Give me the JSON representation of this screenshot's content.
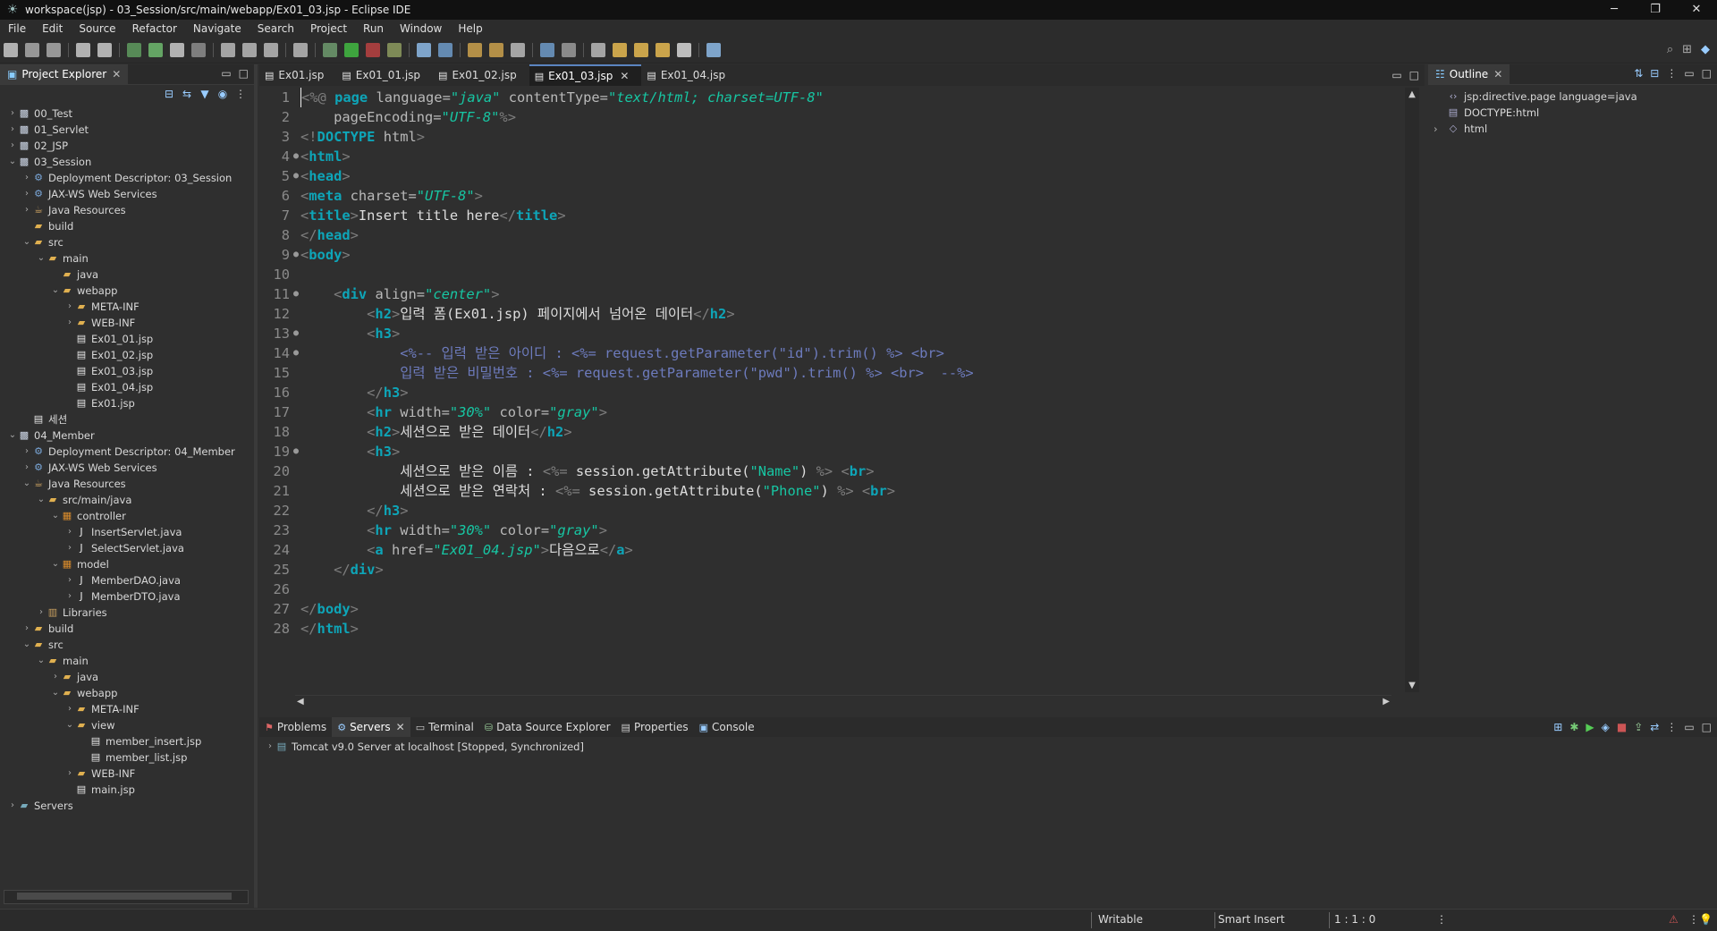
{
  "window": {
    "title": "workspace(jsp) - 03_Session/src/main/webapp/Ex01_03.jsp - Eclipse IDE",
    "controls": [
      "─",
      "❐",
      "✕"
    ]
  },
  "menu": [
    "File",
    "Edit",
    "Source",
    "Refactor",
    "Navigate",
    "Search",
    "Project",
    "Run",
    "Window",
    "Help"
  ],
  "explorer": {
    "tab_label": "Project Explorer",
    "items": [
      {
        "label": "00_Test",
        "depth": 0,
        "arrow": "›",
        "icon": "project"
      },
      {
        "label": "01_Servlet",
        "depth": 0,
        "arrow": "›",
        "icon": "project"
      },
      {
        "label": "02_JSP",
        "depth": 0,
        "arrow": "›",
        "icon": "project"
      },
      {
        "label": "03_Session",
        "depth": 0,
        "arrow": "⌄",
        "icon": "project"
      },
      {
        "label": "Deployment Descriptor: 03_Session",
        "depth": 1,
        "arrow": "›",
        "icon": "descriptor"
      },
      {
        "label": "JAX-WS Web Services",
        "depth": 1,
        "arrow": "›",
        "icon": "service"
      },
      {
        "label": "Java Resources",
        "depth": 1,
        "arrow": "›",
        "icon": "resources"
      },
      {
        "label": "build",
        "depth": 1,
        "arrow": "",
        "icon": "folder"
      },
      {
        "label": "src",
        "depth": 1,
        "arrow": "⌄",
        "icon": "folder"
      },
      {
        "label": "main",
        "depth": 2,
        "arrow": "⌄",
        "icon": "folder"
      },
      {
        "label": "java",
        "depth": 3,
        "arrow": "",
        "icon": "folder"
      },
      {
        "label": "webapp",
        "depth": 3,
        "arrow": "⌄",
        "icon": "folder"
      },
      {
        "label": "META-INF",
        "depth": 4,
        "arrow": "›",
        "icon": "folder"
      },
      {
        "label": "WEB-INF",
        "depth": 4,
        "arrow": "›",
        "icon": "folder"
      },
      {
        "label": "Ex01_01.jsp",
        "depth": 4,
        "arrow": "",
        "icon": "file"
      },
      {
        "label": "Ex01_02.jsp",
        "depth": 4,
        "arrow": "",
        "icon": "file"
      },
      {
        "label": "Ex01_03.jsp",
        "depth": 4,
        "arrow": "",
        "icon": "file"
      },
      {
        "label": "Ex01_04.jsp",
        "depth": 4,
        "arrow": "",
        "icon": "file"
      },
      {
        "label": "Ex01.jsp",
        "depth": 4,
        "arrow": "",
        "icon": "file"
      },
      {
        "label": "세션",
        "depth": 1,
        "arrow": "",
        "icon": "file"
      },
      {
        "label": "04_Member",
        "depth": 0,
        "arrow": "⌄",
        "icon": "project"
      },
      {
        "label": "Deployment Descriptor: 04_Member",
        "depth": 1,
        "arrow": "›",
        "icon": "descriptor"
      },
      {
        "label": "JAX-WS Web Services",
        "depth": 1,
        "arrow": "›",
        "icon": "service"
      },
      {
        "label": "Java Resources",
        "depth": 1,
        "arrow": "⌄",
        "icon": "resources"
      },
      {
        "label": "src/main/java",
        "depth": 2,
        "arrow": "⌄",
        "icon": "folder"
      },
      {
        "label": "controller",
        "depth": 3,
        "arrow": "⌄",
        "icon": "package"
      },
      {
        "label": "InsertServlet.java",
        "depth": 4,
        "arrow": "›",
        "icon": "java"
      },
      {
        "label": "SelectServlet.java",
        "depth": 4,
        "arrow": "›",
        "icon": "java"
      },
      {
        "label": "model",
        "depth": 3,
        "arrow": "⌄",
        "icon": "package"
      },
      {
        "label": "MemberDAO.java",
        "depth": 4,
        "arrow": "›",
        "icon": "java"
      },
      {
        "label": "MemberDTO.java",
        "depth": 4,
        "arrow": "›",
        "icon": "java"
      },
      {
        "label": "Libraries",
        "depth": 2,
        "arrow": "›",
        "icon": "library"
      },
      {
        "label": "build",
        "depth": 1,
        "arrow": "›",
        "icon": "folder"
      },
      {
        "label": "src",
        "depth": 1,
        "arrow": "⌄",
        "icon": "folder"
      },
      {
        "label": "main",
        "depth": 2,
        "arrow": "⌄",
        "icon": "folder"
      },
      {
        "label": "java",
        "depth": 3,
        "arrow": "›",
        "icon": "folder"
      },
      {
        "label": "webapp",
        "depth": 3,
        "arrow": "⌄",
        "icon": "folder"
      },
      {
        "label": "META-INF",
        "depth": 4,
        "arrow": "›",
        "icon": "folder"
      },
      {
        "label": "view",
        "depth": 4,
        "arrow": "⌄",
        "icon": "folder"
      },
      {
        "label": "member_insert.jsp",
        "depth": 5,
        "arrow": "",
        "icon": "file"
      },
      {
        "label": "member_list.jsp",
        "depth": 5,
        "arrow": "",
        "icon": "file"
      },
      {
        "label": "WEB-INF",
        "depth": 4,
        "arrow": "›",
        "icon": "folder"
      },
      {
        "label": "main.jsp",
        "depth": 4,
        "arrow": "",
        "icon": "file"
      },
      {
        "label": "Servers",
        "depth": 0,
        "arrow": "›",
        "icon": "server"
      }
    ]
  },
  "editor": {
    "tabs": [
      {
        "label": "Ex01.jsp",
        "active": false
      },
      {
        "label": "Ex01_01.jsp",
        "active": false
      },
      {
        "label": "Ex01_02.jsp",
        "active": false
      },
      {
        "label": "Ex01_03.jsp",
        "active": true
      },
      {
        "label": "Ex01_04.jsp",
        "active": false
      }
    ],
    "lines": [
      {
        "n": "1",
        "fold": "",
        "html": "<span class='br'>&lt;%@ </span><span class='tag'>page</span> <span class='at'>language=</span><span class='sv'>\"java\"</span> <span class='at'>contentType=</span><span class='sv'>\"text/html; charset=UTF-8\"</span>"
      },
      {
        "n": "2",
        "fold": "",
        "html": "    <span class='at'>pageEncoding=</span><span class='sv'>\"UTF-8\"</span><span class='br'>%&gt;</span>"
      },
      {
        "n": "3",
        "fold": "",
        "html": "<span class='br'>&lt;!</span><span class='tag'>DOCTYPE</span> <span class='at'>html</span><span class='br'>&gt;</span>"
      },
      {
        "n": "4",
        "fold": "●",
        "html": "<span class='br'>&lt;</span><span class='tag'>html</span><span class='br'>&gt;</span>"
      },
      {
        "n": "5",
        "fold": "●",
        "html": "<span class='br'>&lt;</span><span class='tag'>head</span><span class='br'>&gt;</span>"
      },
      {
        "n": "6",
        "fold": "",
        "html": "<span class='br'>&lt;</span><span class='tag'>meta</span> <span class='at'>charset=</span><span class='sv'>\"UTF-8\"</span><span class='br'>&gt;</span>"
      },
      {
        "n": "7",
        "fold": "",
        "html": "<span class='br'>&lt;</span><span class='tag'>title</span><span class='br'>&gt;</span><span class='tx'>Insert title here</span><span class='br'>&lt;/</span><span class='tag'>title</span><span class='br'>&gt;</span>"
      },
      {
        "n": "8",
        "fold": "",
        "html": "<span class='br'>&lt;/</span><span class='tag'>head</span><span class='br'>&gt;</span>"
      },
      {
        "n": "9",
        "fold": "●",
        "html": "<span class='br'>&lt;</span><span class='tag'>body</span><span class='br'>&gt;</span>"
      },
      {
        "n": "10",
        "fold": "",
        "html": ""
      },
      {
        "n": "11",
        "fold": "●",
        "html": "    <span class='br'>&lt;</span><span class='tag'>div</span> <span class='at'>align=</span><span class='sv'>\"center\"</span><span class='br'>&gt;</span>"
      },
      {
        "n": "12",
        "fold": "",
        "html": "        <span class='br'>&lt;</span><span class='tag'>h2</span><span class='br'>&gt;</span><span class='tx'>입력 폼(Ex01.jsp) 페이지에서 넘어온 데이터</span><span class='br'>&lt;/</span><span class='tag'>h2</span><span class='br'>&gt;</span>"
      },
      {
        "n": "13",
        "fold": "●",
        "html": "        <span class='br'>&lt;</span><span class='tag'>h3</span><span class='br'>&gt;</span>"
      },
      {
        "n": "14",
        "fold": "●",
        "html": "            <span class='cm'>&lt;%-- 입력 받은 아이디 : &lt;%= request.getParameter(\"id\").trim() %&gt; &lt;br&gt;</span>"
      },
      {
        "n": "15",
        "fold": "",
        "html": "            <span class='cm'>입력 받은 비밀번호 : &lt;%= request.getParameter(\"pwd\").trim() %&gt; &lt;br&gt;  --%&gt;</span>"
      },
      {
        "n": "16",
        "fold": "",
        "html": "        <span class='br'>&lt;/</span><span class='tag'>h3</span><span class='br'>&gt;</span>"
      },
      {
        "n": "17",
        "fold": "",
        "html": "        <span class='br'>&lt;</span><span class='tag'>hr</span> <span class='at'>width=</span><span class='sv'>\"30%\"</span> <span class='at'>color=</span><span class='sv'>\"gray\"</span><span class='br'>&gt;</span>"
      },
      {
        "n": "18",
        "fold": "",
        "html": "        <span class='br'>&lt;</span><span class='tag'>h2</span><span class='br'>&gt;</span><span class='tx'>세션으로 받은 데이터</span><span class='br'>&lt;/</span><span class='tag'>h2</span><span class='br'>&gt;</span>"
      },
      {
        "n": "19",
        "fold": "●",
        "html": "        <span class='br'>&lt;</span><span class='tag'>h3</span><span class='br'>&gt;</span>"
      },
      {
        "n": "20",
        "fold": "",
        "html": "            <span class='tx'>세션으로 받은 이름 : </span><span class='br'>&lt;%=</span><span class='tx'> session.getAttribute(</span><span class='sv' style='font-style:normal'>\"Name\"</span><span class='tx'>) </span><span class='br'>%&gt;</span> <span class='br'>&lt;</span><span class='tag'>br</span><span class='br'>&gt;</span>"
      },
      {
        "n": "21",
        "fold": "",
        "html": "            <span class='tx'>세션으로 받은 연락처 : </span><span class='br'>&lt;%=</span><span class='tx'> session.getAttribute(</span><span class='sv' style='font-style:normal'>\"Phone\"</span><span class='tx'>) </span><span class='br'>%&gt;</span> <span class='br'>&lt;</span><span class='tag'>br</span><span class='br'>&gt;</span>"
      },
      {
        "n": "22",
        "fold": "",
        "html": "        <span class='br'>&lt;/</span><span class='tag'>h3</span><span class='br'>&gt;</span>"
      },
      {
        "n": "23",
        "fold": "",
        "html": "        <span class='br'>&lt;</span><span class='tag'>hr</span> <span class='at'>width=</span><span class='sv'>\"30%\"</span> <span class='at'>color=</span><span class='sv'>\"gray\"</span><span class='br'>&gt;</span>"
      },
      {
        "n": "24",
        "fold": "",
        "html": "        <span class='br'>&lt;</span><span class='tag'>a</span> <span class='at'>href=</span><span class='sv'>\"Ex01_04.jsp\"</span><span class='br'>&gt;</span><span class='tx'>다음으로</span><span class='br'>&lt;/</span><span class='tag'>a</span><span class='br'>&gt;</span>"
      },
      {
        "n": "25",
        "fold": "",
        "html": "    <span class='br'>&lt;/</span><span class='tag'>div</span><span class='br'>&gt;</span>"
      },
      {
        "n": "26",
        "fold": "",
        "html": ""
      },
      {
        "n": "27",
        "fold": "",
        "html": "<span class='br'>&lt;/</span><span class='tag'>body</span><span class='br'>&gt;</span>"
      },
      {
        "n": "28",
        "fold": "",
        "html": "<span class='br'>&lt;/</span><span class='tag'>html</span><span class='br'>&gt;</span>"
      }
    ]
  },
  "outline": {
    "tab_label": "Outline",
    "items": [
      {
        "label": "jsp:directive.page language=java",
        "arrow": "",
        "icon": "‹›"
      },
      {
        "label": "DOCTYPE:html",
        "arrow": "",
        "icon": "▤"
      },
      {
        "label": "html",
        "arrow": "›",
        "icon": "◇"
      }
    ]
  },
  "bottom": {
    "tabs": [
      {
        "label": "Problems",
        "icon": "⚑",
        "active": false
      },
      {
        "label": "Servers",
        "icon": "⚙",
        "active": true
      },
      {
        "label": "Terminal",
        "icon": "▭",
        "active": false
      },
      {
        "label": "Data Source Explorer",
        "icon": "⛁",
        "active": false
      },
      {
        "label": "Properties",
        "icon": "▤",
        "active": false
      },
      {
        "label": "Console",
        "icon": "▣",
        "active": false
      }
    ],
    "server_entry": "Tomcat v9.0 Server at localhost  [Stopped, Synchronized]"
  },
  "status": {
    "writable": "Writable",
    "insert_mode": "Smart Insert",
    "position": "1 : 1 : 0"
  },
  "colors": {
    "tag": "#0ea5b8",
    "string": "#17c6a3",
    "comment": "#6d7bbd",
    "background": "#2f2f2f"
  }
}
